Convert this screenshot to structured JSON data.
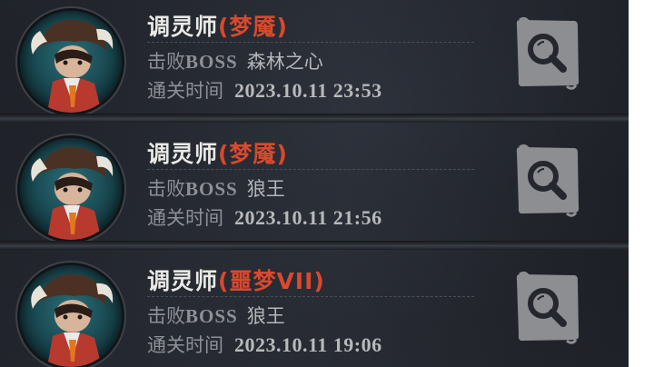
{
  "records": [
    {
      "class_name": "调灵师",
      "difficulty": "(梦魇)",
      "defeat_label": "击败",
      "boss_label": "BOSS",
      "boss_name": "森林之心",
      "time_label": "通关时间",
      "time_value": "2023.10.11 23:53"
    },
    {
      "class_name": "调灵师",
      "difficulty": "(梦魇)",
      "defeat_label": "击败",
      "boss_label": "BOSS",
      "boss_name": "狼王",
      "time_label": "通关时间",
      "time_value": "2023.10.11 21:56"
    },
    {
      "class_name": "调灵师",
      "difficulty": "(噩梦VII)",
      "defeat_label": "击败",
      "boss_label": "BOSS",
      "boss_name": "狼王",
      "time_label": "通关时间",
      "time_value": "2023.10.11 19:06"
    }
  ],
  "colors": {
    "difficulty": "#d9492d",
    "title": "#e9e9e6",
    "secondary": "#8f9298",
    "button": "#8c8e91"
  },
  "icons": {
    "avatar": "character-portrait-icon",
    "search": "magnifier-icon"
  }
}
